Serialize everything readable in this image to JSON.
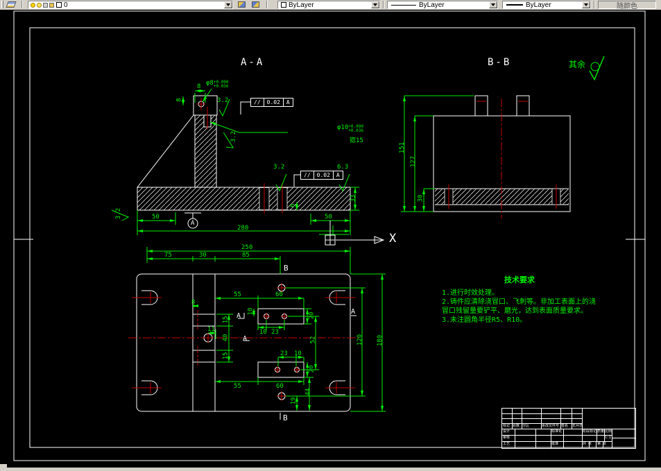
{
  "toolbar": {
    "layer_name": "0",
    "color_value": "ByLayer",
    "linetype_value": "ByLayer",
    "lineweight_value": "ByLayer",
    "plot_style_value": "随颜色"
  },
  "sections": {
    "aa_label": "A-A",
    "bb_label": "B-B",
    "rest_label": "其余",
    "axis_x_label": "X"
  },
  "aa": {
    "dim_8_top": "8",
    "dim_8_left": "8",
    "phi8": "φ8",
    "phi8_up": "+0.090",
    "phi8_low": "+0.036",
    "phi10": "φ10",
    "phi10_up": "+0.090",
    "phi10_low": "+0.036",
    "counterbore": "锪15",
    "sf_top": "3.2",
    "sf_mid": "3.2",
    "sf_base": "3.2",
    "sf_63": "6.3",
    "sf_left": "3.2",
    "fcf1": {
      "sym": "//",
      "tol": "0.02",
      "datum": "A"
    },
    "fcf2": {
      "sym": "//",
      "tol": "0.02",
      "datum": "A"
    },
    "datum_label": "A",
    "dims": {
      "d50l": "50",
      "d280": "280",
      "d50r": "50",
      "d33": "33",
      "d6": "6"
    }
  },
  "bb": {
    "dims": {
      "d151": "151",
      "d127": "127",
      "d30": "30"
    }
  },
  "plan": {
    "dims": {
      "d250": "250",
      "d75": "75",
      "d30": "30",
      "d85": "85",
      "d55t": "55",
      "d60t": "60",
      "d10v": "10",
      "d10a": "10",
      "d23a": "23",
      "d20t": "20",
      "d15a": "15",
      "d40": "40",
      "d15b": "15",
      "d11": "11",
      "d8": "8",
      "d23b": "23",
      "d10b": "10",
      "d20b": "20",
      "d55b": "55",
      "d60b": "60",
      "d44": "44",
      "d19": "19",
      "d52": "52",
      "d120": "120",
      "d180": "180"
    },
    "marks": {
      "b_top": "B",
      "b_bottom": "B",
      "a_left": "A",
      "a_mid": "A",
      "a_right": "A"
    }
  },
  "tech": {
    "title": "技术要求",
    "lines": [
      "1.进行时效处理。",
      "2.铸件应清除浇冒口、飞刺等。非加工表面上的浇",
      "冒口残留量要铲平、磨光，达到表面质量要求。",
      "3.未注圆角半径R5、R10。"
    ]
  },
  "title_block": {
    "rev_headers": [
      "标记",
      "处数",
      "分区",
      "更改文件号",
      "签名",
      "年月日"
    ],
    "roles": [
      "设计",
      "审核",
      "工艺"
    ],
    "col2": [
      "标准化",
      "批准"
    ],
    "stage": "阶段标记",
    "mass": "质量",
    "scale": "比例",
    "scale_value": "1:1",
    "sheet": "共 张",
    "page": "第 张"
  }
}
